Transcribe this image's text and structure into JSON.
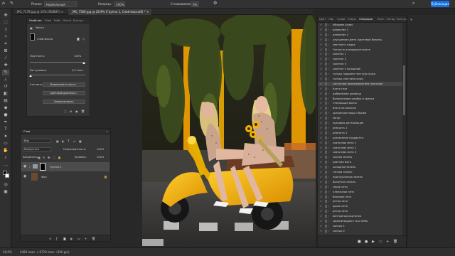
{
  "options_bar": {
    "mode_label": "Режим:",
    "mode_value": "Нормальный",
    "opacity_label": "Непрозр.:",
    "opacity_value": "100%",
    "smoothing_label": "Сглаживание:",
    "smoothing_value": "0%",
    "publish_label": "Публикация"
  },
  "tabs": [
    {
      "label": "_MG_7178.jpg @ 15% (RGB/8*)"
    },
    {
      "label": "_MG_7566.jpg @ 28,9% (Группа 1, Слой-маска/8) *"
    }
  ],
  "properties_panel": {
    "tabs": [
      "Свойства",
      "Корр",
      "Библ",
      "Кисти",
      "Контур"
    ],
    "section_title": "Маски",
    "mask_label": "Слой-маска",
    "density_label": "Плотность:",
    "density_value": "100%",
    "feather_label": "Растушевка:",
    "feather_value": "0,0 пикс.",
    "refine_label": "Уточнить:",
    "select_mask_button": "Выделение и маска...",
    "color_range_button": "Цветовой диапазон...",
    "invert_button": "Инвертировать"
  },
  "layers_panel": {
    "title": "Слои",
    "search_value": "Вид",
    "blend_mode": "Пропустить",
    "opacity_label": "Непрозрачность:",
    "opacity_value": "100%",
    "lock_label": "Закрепить:",
    "fill_label": "Заливка:",
    "fill_value": "100%",
    "layers": [
      {
        "name": "Группа 1"
      },
      {
        "name": "Фон"
      }
    ]
  },
  "actions_panel": {
    "tabs": [
      "Цвет",
      "Обр",
      "Гради",
      "Узоры",
      "Операции",
      "Канн",
      "Истор",
      "Контур"
    ],
    "items": [
      "убираем шумы",
      "размытие 1",
      "размытие 2",
      "улучшение цвета (цветовой баланс)",
      "светлость кадра",
      "Четкость в микроконтрасте",
      "скинтон 1",
      "скинтон 2",
      "скинтон 3",
      "скинтон 4 холодный",
      "только придаем текстуру кожи",
      "только смягчаем кожу",
      "частотное разложение без плагинов",
      "блеск глаз",
      "добавление румянца",
      "белоснежная улыбка и зрачки",
      "стекающая волна",
      "блеск на волосах",
      "красим ресницы и брови",
      "загар",
      "красивая детализация",
      "резкость 1",
      "резкость 2",
      "разнесение градиента",
      "сказочная мята 1",
      "сказочная мята 2",
      "сказочная мята 3",
      "сочная зелень",
      "цветная мята",
      "холодная зелень",
      "теплая зелень",
      "приглушенная зелень",
      "болотная зелень",
      "серое лето",
      "пленочное лето",
      "бежевое лето",
      "ретро лето",
      "яркое лето",
      "ретро лето",
      "винтажная картинка",
      "зимний вариант или небо",
      "солнце 1",
      "солнце 2"
    ]
  },
  "status_bar": {
    "zoom": "28,9%",
    "doc_size": "4480 пикс. x 6720 пикс. (300 ppi)"
  },
  "tools": [
    "move-icon",
    "marquee-icon",
    "lasso-icon",
    "quick-select-icon",
    "crop-icon",
    "frame-icon",
    "eyedropper-icon",
    "healing-icon",
    "brush-icon",
    "stamp-icon",
    "history-brush-icon",
    "eraser-icon",
    "gradient-icon",
    "blur-icon",
    "dodge-icon",
    "pen-icon",
    "type-icon",
    "path-select-icon",
    "shape-icon",
    "hand-icon",
    "zoom-icon",
    "more-icon",
    "color-swatch-icon",
    "quick-mask-icon",
    "screen-mode-icon"
  ],
  "colors": {
    "accent": "#1473e6",
    "panel_bg": "#363636",
    "app_bg": "#262626"
  }
}
